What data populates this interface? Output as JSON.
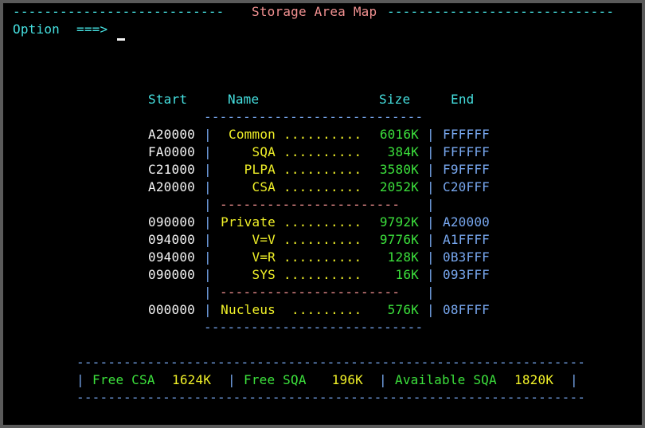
{
  "header": {
    "dashes_left": "---------------------------",
    "title": "Storage Area Map",
    "dashes_right": "-----------------------------"
  },
  "command": {
    "label": "Option",
    "arrow": "===>",
    "value": ""
  },
  "columns": {
    "start": "Start",
    "name": "Name",
    "size": "Size",
    "end": "End"
  },
  "rule_top": "----------------------------",
  "sep_mid": "-----------------------",
  "rule_bottom": "----------------------------",
  "rows": [
    {
      "start": "A20000",
      "name": "Common",
      "dots": "..........",
      "size": "6016K",
      "end": "FFFFFF"
    },
    {
      "start": "FA0000",
      "name": "SQA",
      "dots": "..........",
      "size": "384K",
      "end": "FFFFFF"
    },
    {
      "start": "C21000",
      "name": "PLPA",
      "dots": "..........",
      "size": "3580K",
      "end": "F9FFFF"
    },
    {
      "start": "A20000",
      "name": "CSA",
      "dots": "..........",
      "size": "2052K",
      "end": "C20FFF"
    },
    {
      "start": "090000",
      "name": "Private",
      "dots": "..........",
      "size": "9792K",
      "end": "A20000"
    },
    {
      "start": "094000",
      "name": "V=V",
      "dots": "..........",
      "size": "9776K",
      "end": "A1FFFF"
    },
    {
      "start": "094000",
      "name": "V=R",
      "dots": "..........",
      "size": "128K",
      "end": "0B3FFF"
    },
    {
      "start": "090000",
      "name": "SYS",
      "dots": "..........",
      "size": "16K",
      "end": "093FFF"
    },
    {
      "start": "000000",
      "name": "Nucleus",
      "dots": ".........",
      "size": "576K",
      "end": "08FFFF"
    }
  ],
  "bar": "|",
  "summary": {
    "rule": "-----------------------------------------------------------------",
    "free_csa_label": "Free CSA",
    "free_csa_value": "1624K",
    "free_sqa_label": "Free SQA",
    "free_sqa_value": "196K",
    "avail_sqa_label": "Available SQA",
    "avail_sqa_value": "1820K"
  },
  "colors": {
    "background": "#000000",
    "cyan": "#45e0e0",
    "yellow": "#f0f028",
    "green": "#3ce03c",
    "white": "#f4f4f4",
    "blue": "#78a8f0",
    "pink": "#f09090"
  }
}
